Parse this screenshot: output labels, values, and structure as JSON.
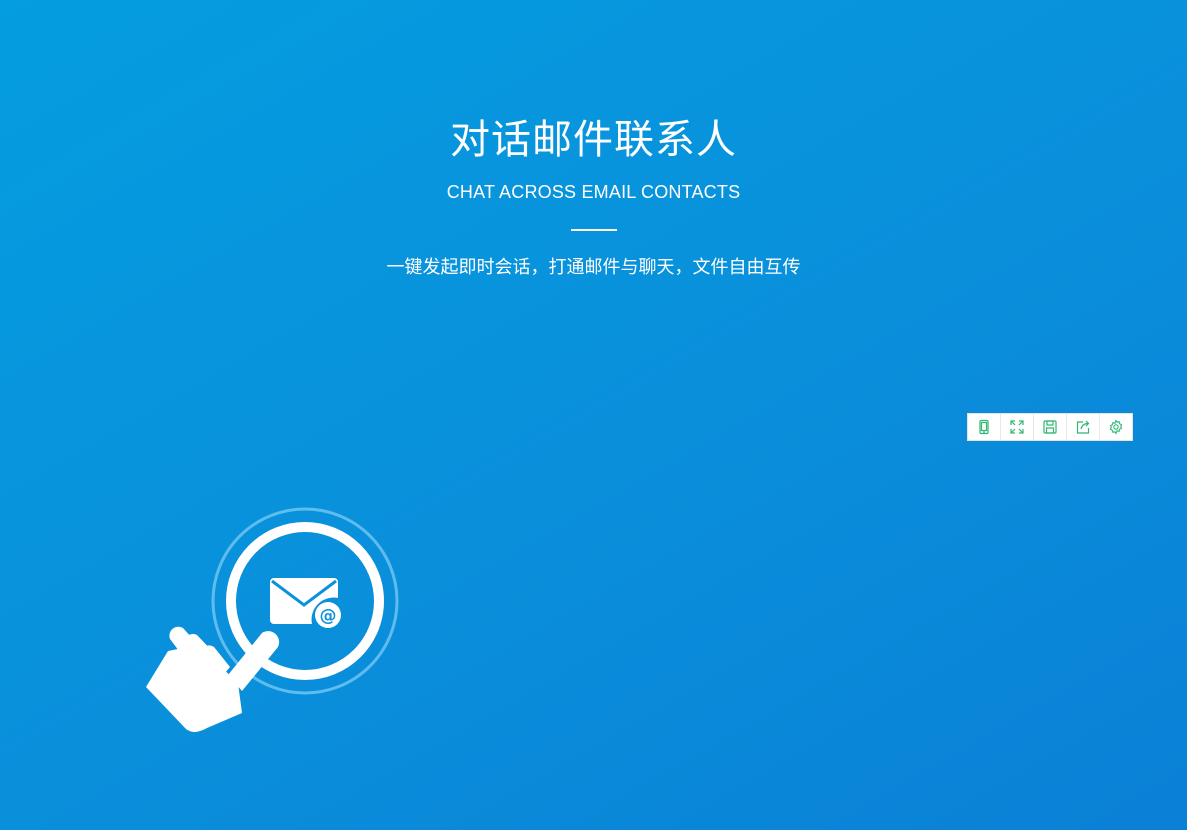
{
  "hero": {
    "title": "对话邮件联系人",
    "subtitle": "CHAT ACROSS EMAIL CONTACTS",
    "tagline": "一键发起即时会话，打通邮件与聊天，文件自由互传"
  },
  "toolbar": {
    "items": [
      {
        "icon": "mobile-icon"
      },
      {
        "icon": "fullscreen-icon"
      },
      {
        "icon": "save-icon"
      },
      {
        "icon": "share-icon"
      },
      {
        "icon": "settings-gear-icon"
      }
    ],
    "icon_color": "#2eb872"
  },
  "illustration": {
    "icons": [
      "hand-pointer-icon",
      "email-at-icon"
    ]
  },
  "colors": {
    "background_start": "#049ddf",
    "background_end": "#0a80d6",
    "text": "#ffffff"
  }
}
